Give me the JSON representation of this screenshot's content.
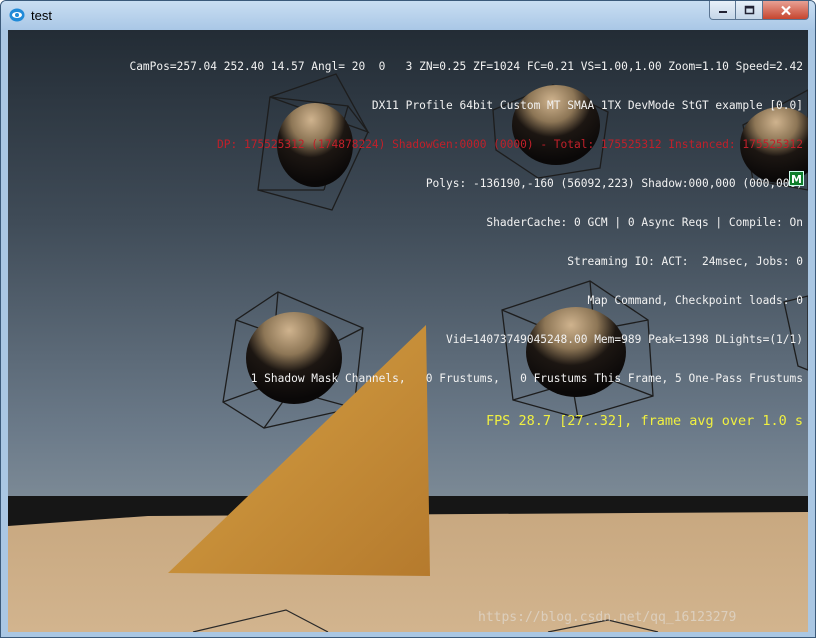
{
  "window": {
    "title": "test",
    "controls": [
      "minimize-button",
      "maximize-button",
      "close-button"
    ]
  },
  "hud": {
    "lines": [
      "CamPos=257.04 252.40 14.57 Angl= 20  0   3 ZN=0.25 ZF=1024 FC=0.21 VS=1.00,1.00 Zoom=1.10 Speed=2.42",
      "DX11 Profile 64bit Custom MT SMAA 1TX DevMode StGT example [0.0]",
      "DP: 175525312 (174878224) ShadowGen:0000 (0000) - Total: 175525312 Instanced: 175525312",
      "Polys: -136190,-160 (56092,223) Shadow:000,000 (000,000)",
      "ShaderCache: 0 GCM | 0 Async Reqs | Compile: On",
      "Streaming IO: ACT:  24msec, Jobs: 0",
      "Map Command, Checkpoint loads: 0",
      "Vid=14073749045248.00 Mem=989 Peak=1398 DLights=(1/1)",
      "1 Shadow Mask Channels,   0 Frustums,   0 Frustums This Frame, 5 One-Pass Frustums"
    ],
    "fps": "FPS 28.7 [27..32], frame avg over 1.0 s",
    "badge": "M",
    "colors": {
      "normal": "#f2f2f2",
      "warning": "#c0202a",
      "fps": "#f0f040"
    }
  },
  "watermark": "https://blog.csdn.net/qq_16123279"
}
